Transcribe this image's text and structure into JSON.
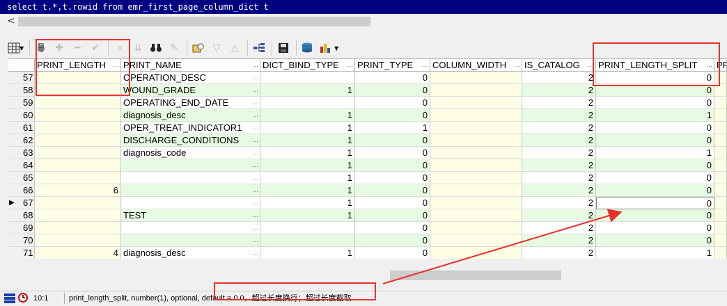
{
  "sql_text": "select t.*,t.rowid from emr_first_page_column_dict t",
  "scroll_left_arrow": "<",
  "columns": [
    {
      "label": "PRINT_LENGTH"
    },
    {
      "label": "PRINT_NAME"
    },
    {
      "label": "DICT_BIND_TYPE"
    },
    {
      "label": "PRINT_TYPE"
    },
    {
      "label": "COLUMN_WIDTH"
    },
    {
      "label": "IS_CATALOG"
    },
    {
      "label": "PRINT_LENGTH_SPLIT"
    },
    {
      "label": "PR"
    }
  ],
  "current_row_marker": "▶",
  "rows": [
    {
      "num": "57",
      "print_length": "",
      "print_name": "OPERATION_DESC",
      "dict_bind_type": "",
      "print_type": "0",
      "column_width": "",
      "is_catalog": "2",
      "print_length_split": "0"
    },
    {
      "num": "58",
      "print_length": "",
      "print_name": "WOUND_GRADE",
      "dict_bind_type": "1",
      "print_type": "0",
      "column_width": "",
      "is_catalog": "2",
      "print_length_split": "0"
    },
    {
      "num": "59",
      "print_length": "",
      "print_name": "OPERATING_END_DATE",
      "dict_bind_type": "",
      "print_type": "0",
      "column_width": "",
      "is_catalog": "2",
      "print_length_split": "0"
    },
    {
      "num": "60",
      "print_length": "",
      "print_name": "diagnosis_desc",
      "dict_bind_type": "1",
      "print_type": "0",
      "column_width": "",
      "is_catalog": "2",
      "print_length_split": "1"
    },
    {
      "num": "61",
      "print_length": "",
      "print_name": "OPER_TREAT_INDICATOR1",
      "dict_bind_type": "1",
      "print_type": "1",
      "column_width": "",
      "is_catalog": "2",
      "print_length_split": "0"
    },
    {
      "num": "62",
      "print_length": "",
      "print_name": "DISCHARGE_CONDITIONS",
      "dict_bind_type": "1",
      "print_type": "0",
      "column_width": "",
      "is_catalog": "2",
      "print_length_split": "0"
    },
    {
      "num": "63",
      "print_length": "",
      "print_name": "diagnosis_code",
      "dict_bind_type": "1",
      "print_type": "0",
      "column_width": "",
      "is_catalog": "2",
      "print_length_split": "1"
    },
    {
      "num": "64",
      "print_length": "",
      "print_name": "",
      "dict_bind_type": "1",
      "print_type": "0",
      "column_width": "",
      "is_catalog": "2",
      "print_length_split": "0"
    },
    {
      "num": "65",
      "print_length": "",
      "print_name": "",
      "dict_bind_type": "1",
      "print_type": "0",
      "column_width": "",
      "is_catalog": "2",
      "print_length_split": "0"
    },
    {
      "num": "66",
      "print_length": "6",
      "print_name": "",
      "dict_bind_type": "1",
      "print_type": "0",
      "column_width": "",
      "is_catalog": "2",
      "print_length_split": "0"
    },
    {
      "num": "67",
      "print_length": "",
      "print_name": "",
      "dict_bind_type": "1",
      "print_type": "0",
      "column_width": "",
      "is_catalog": "2",
      "print_length_split": "0"
    },
    {
      "num": "68",
      "print_length": "",
      "print_name": "TEST",
      "dict_bind_type": "1",
      "print_type": "0",
      "column_width": "",
      "is_catalog": "2",
      "print_length_split": "0"
    },
    {
      "num": "69",
      "print_length": "",
      "print_name": "",
      "dict_bind_type": "",
      "print_type": "0",
      "column_width": "",
      "is_catalog": "2",
      "print_length_split": "0"
    },
    {
      "num": "70",
      "print_length": "",
      "print_name": "",
      "dict_bind_type": "",
      "print_type": "0",
      "column_width": "",
      "is_catalog": "2",
      "print_length_split": "0"
    },
    {
      "num": "71",
      "print_length": "4",
      "print_name": "diagnosis_desc",
      "dict_bind_type": "1",
      "print_type": "0",
      "column_width": "",
      "is_catalog": "2",
      "print_length_split": "1"
    }
  ],
  "status": {
    "position": "10:1",
    "message": "print_length_split, number(1), optional, default = 0.0，超过长度换行；超过长度截取"
  },
  "colors": {
    "sql_bg": "#000080",
    "row_alt_green": "#e6fbe2",
    "yellow_col": "#fdfee5",
    "annotation_red": "#e8322e"
  }
}
